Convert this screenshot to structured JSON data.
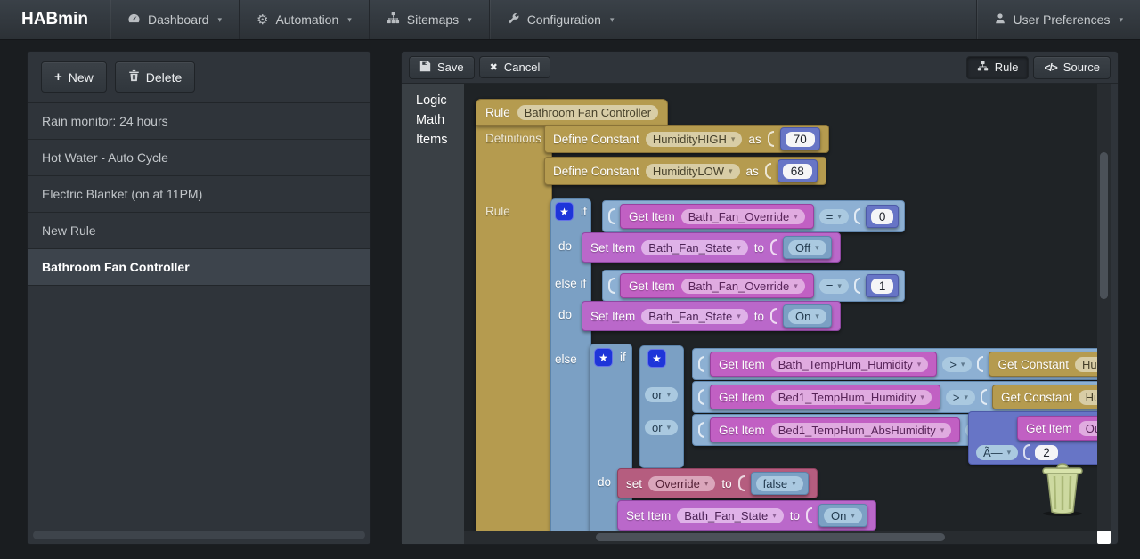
{
  "navbar": {
    "brand": "HABmin",
    "items": [
      {
        "label": "Dashboard",
        "icon": "dashboard-icon"
      },
      {
        "label": "Automation",
        "icon": "gears-icon"
      },
      {
        "label": "Sitemaps",
        "icon": "sitemap-icon"
      },
      {
        "label": "Configuration",
        "icon": "wrench-icon"
      }
    ],
    "user": "User Preferences"
  },
  "sidebar": {
    "new_label": "New",
    "delete_label": "Delete",
    "rules": [
      "Rain monitor: 24 hours",
      "Hot Water - Auto Cycle",
      "Electric Blanket (on at 11PM)",
      "New Rule",
      "Bathroom Fan Controller"
    ],
    "selected_rule": "Bathroom Fan Controller"
  },
  "toolbar": {
    "save": "Save",
    "cancel": "Cancel",
    "rule": "Rule",
    "source": "Source"
  },
  "palette": {
    "categories": [
      "Logic",
      "Math",
      "Items"
    ]
  },
  "icons": {
    "star": "★",
    "caret": "▾",
    "plus": "+",
    "cancel_glyph": "✖",
    "source_glyph": "</>"
  },
  "colors": {
    "block_tan": "#b59b4f",
    "block_blue": "#7ba0c4",
    "block_magenta": "#c160c3",
    "block_orchid": "#ba68ca",
    "block_rose": "#b55d7f",
    "block_indigo": "#6775c6",
    "workspace_bg": "#1f2326",
    "panel_bg": "#2f343a"
  },
  "workspace": {
    "rule": {
      "label": "Rule",
      "name": "Bathroom Fan Controller"
    },
    "definitions_label": "Definitions",
    "rule_section_label": "Rule",
    "defines": [
      {
        "label": "Define Constant",
        "name": "HumidityHIGH",
        "as": "as",
        "value": "70"
      },
      {
        "label": "Define Constant",
        "name": "HumidityLOW",
        "as": "as",
        "value": "68"
      }
    ],
    "kw": {
      "if": "if",
      "do": "do",
      "else_if": "else if",
      "else": "else",
      "or": "or"
    },
    "cond1": {
      "label": "Get Item",
      "item": "Bath_Fan_Override",
      "op": "=",
      "value": "0"
    },
    "action1": {
      "label": "Set Item",
      "item": "Bath_Fan_State",
      "to": "to",
      "value": "Off"
    },
    "cond2": {
      "label": "Get Item",
      "item": "Bath_Fan_Override",
      "op": "=",
      "value": "1"
    },
    "action2": {
      "label": "Set Item",
      "item": "Bath_Fan_State",
      "to": "to",
      "value": "On"
    },
    "or_rows": [
      {
        "label": "Get Item",
        "item": "Bath_TempHum_Humidity",
        "op": ">",
        "rhs_label": "Get Constant",
        "rhs": "HumidityHIGH"
      },
      {
        "label": "Get Item",
        "item": "Bed1_TempHum_Humidity",
        "op": ">",
        "rhs_label": "Get Constant",
        "rhs": "HumidityHIGH"
      },
      {
        "label": "Get Item",
        "item": "Bed1_TempHum_AbsHumidity",
        "op": ">"
      }
    ],
    "arith": {
      "label": "Get Item",
      "item": "Out",
      "op": "Ã—",
      "value": "2"
    },
    "set_var": {
      "label": "set",
      "name": "Override",
      "to": "to",
      "value": "false"
    },
    "action3": {
      "label": "Set Item",
      "item": "Bath_Fan_State",
      "to": "to",
      "value": "On"
    }
  }
}
